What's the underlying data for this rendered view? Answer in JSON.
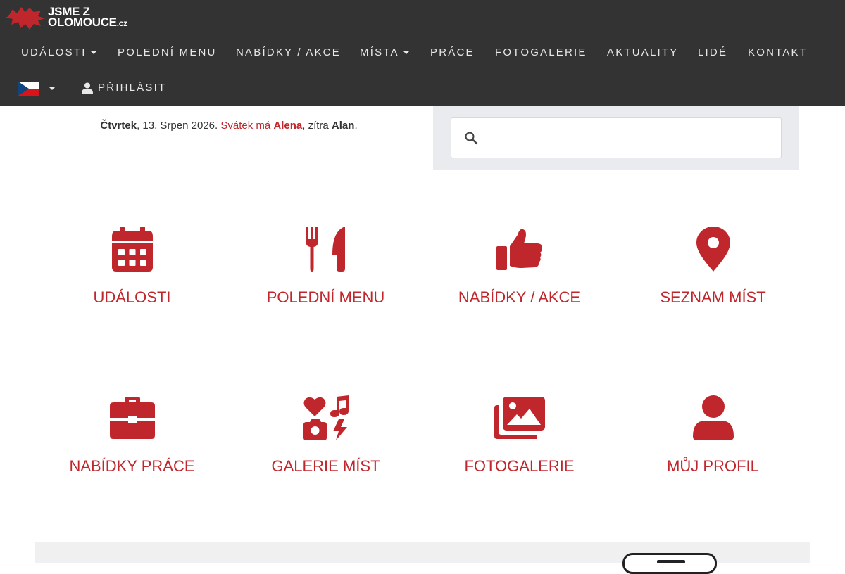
{
  "brand": {
    "line1": "JSME Z",
    "line2": "OLOMOUCE",
    "suffix": ".cz"
  },
  "nav": {
    "events": "UDÁLOSTI",
    "lunch": "POLEDNÍ MENU",
    "offers": "NABÍDKY / AKCE",
    "places": "MÍSTA",
    "jobs": "PRÁCE",
    "gallery": "FOTOGALERIE",
    "news": "AKTUALITY",
    "people": "LIDÉ",
    "contact": "KONTAKT",
    "login": "PŘIHLÁSIT"
  },
  "dateline": {
    "day": "Čtvrtek",
    "date": ", 13. Srpen 2026. ",
    "nameday_label": "Svátek má ",
    "name_today": "Alena",
    "tomorrow_label": ", zítra ",
    "name_tomorrow": "Alan",
    "end": "."
  },
  "search": {
    "placeholder": ""
  },
  "tiles": {
    "events": "UDÁLOSTI",
    "lunch": "POLEDNÍ MENU",
    "offers": "NABÍDKY / AKCE",
    "places": "SEZNAM MÍST",
    "jobs": "NABÍDKY PRÁCE",
    "gallery_places": "GALERIE MÍST",
    "photo_gallery": "FOTOGALERIE",
    "profile": "MŮJ PROFIL"
  },
  "icons": {
    "events": "calendar-icon",
    "lunch": "utensils-icon",
    "offers": "thumbs-up-icon",
    "places": "map-marker-icon",
    "jobs": "briefcase-icon",
    "gallery_places": "photo-video-icon",
    "photo_gallery": "images-icon",
    "profile": "user-icon"
  },
  "colors": {
    "accent": "#c0272d",
    "navbar": "#333333",
    "search_panel": "#e9ebee"
  }
}
